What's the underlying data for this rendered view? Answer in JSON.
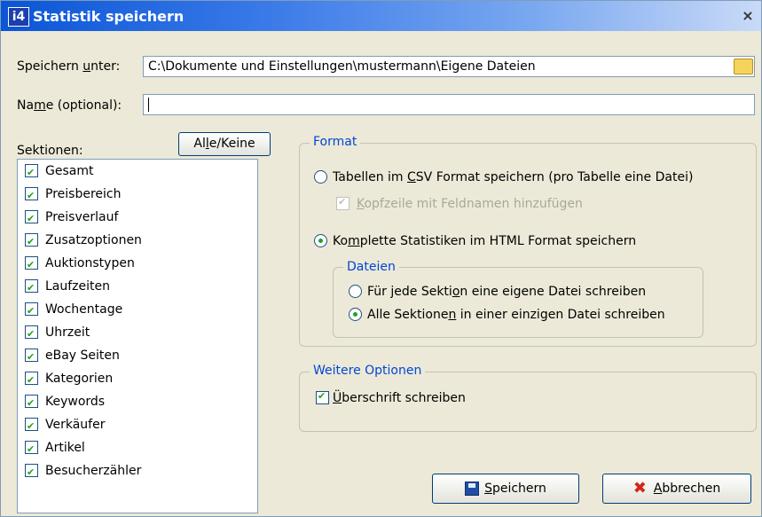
{
  "window": {
    "title": "Statistik speichern",
    "close_glyph": "×"
  },
  "save_under": {
    "label": "Speichern unter:",
    "value": "C:\\Dokumente und Einstellungen\\mustermann\\Eigene Dateien",
    "icon": "folder-icon"
  },
  "name_field": {
    "label": "Name (optional):",
    "value": ""
  },
  "sections": {
    "label": "Sektionen:",
    "toggle_button": "Alle/Keine",
    "items": [
      {
        "label": "Gesamt",
        "checked": true
      },
      {
        "label": "Preisbereich",
        "checked": true
      },
      {
        "label": "Preisverlauf",
        "checked": true
      },
      {
        "label": "Zusatzoptionen",
        "checked": true
      },
      {
        "label": "Auktionstypen",
        "checked": true
      },
      {
        "label": "Laufzeiten",
        "checked": true
      },
      {
        "label": "Wochentage",
        "checked": true
      },
      {
        "label": "Uhrzeit",
        "checked": true
      },
      {
        "label": "eBay Seiten",
        "checked": true
      },
      {
        "label": "Kategorien",
        "checked": true
      },
      {
        "label": "Keywords",
        "checked": true
      },
      {
        "label": "Verkäufer",
        "checked": true
      },
      {
        "label": "Artikel",
        "checked": true
      },
      {
        "label": "Besucherzähler",
        "checked": true
      }
    ]
  },
  "format": {
    "title": "Format",
    "csv_option": "Tabellen im CSV Format speichern (pro Tabelle eine Datei)",
    "csv_header_checkbox": "Kopfzeile mit Feldnamen hinzufügen",
    "html_option": "Komplette Statistiken im HTML Format speichern",
    "files_group": {
      "title": "Dateien",
      "per_section": "Für jede Sektion eine eigene Datei schreiben",
      "single_file": "Alle Sektionen in einer einzigen Datei schreiben"
    }
  },
  "more_options": {
    "title": "Weitere Optionen",
    "write_heading": "Überschrift schreiben"
  },
  "buttons": {
    "save": "Speichern",
    "cancel": "Abbrechen"
  }
}
